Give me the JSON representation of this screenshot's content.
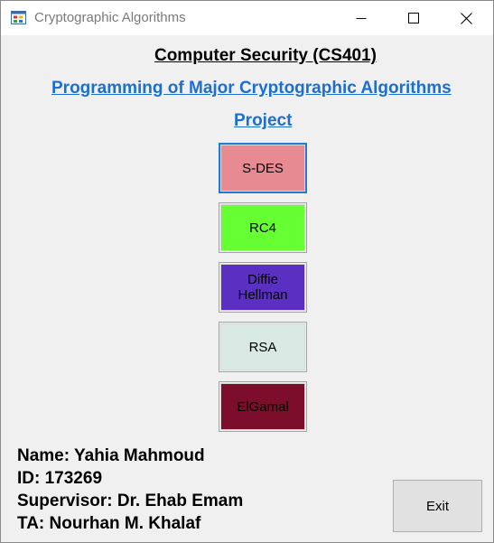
{
  "window": {
    "title": "Cryptographic Algorithms",
    "background": "#f0f0f0",
    "icon": "app-form-icon"
  },
  "title_controls": {
    "minimize_icon": "minimize-icon",
    "maximize_icon": "maximize-icon",
    "close_icon": "close-icon"
  },
  "header": {
    "course": "Computer Security (CS401)",
    "project_title": "Programming of Major Cryptographic Algorithms",
    "project_label": "Project",
    "link_color": "#1c6fd1"
  },
  "algorithms": [
    {
      "label": "S-DES",
      "color": "#e88a91",
      "focused": true
    },
    {
      "label": "RC4",
      "color": "#66ff33",
      "focused": false
    },
    {
      "label": "Diffie\nHellman",
      "color": "#5b2fc2",
      "focused": false
    },
    {
      "label": "RSA",
      "color": "#d9e9e3",
      "focused": false
    },
    {
      "label": "ElGamal",
      "color": "#7d0e2b",
      "focused": false
    }
  ],
  "student_info": {
    "name": "Name: Yahia Mahmoud",
    "id": "ID: 173269",
    "supervisor": "Supervisor: Dr. Ehab Emam",
    "ta": "TA: Nourhan M. Khalaf"
  },
  "exit_label": "Exit"
}
